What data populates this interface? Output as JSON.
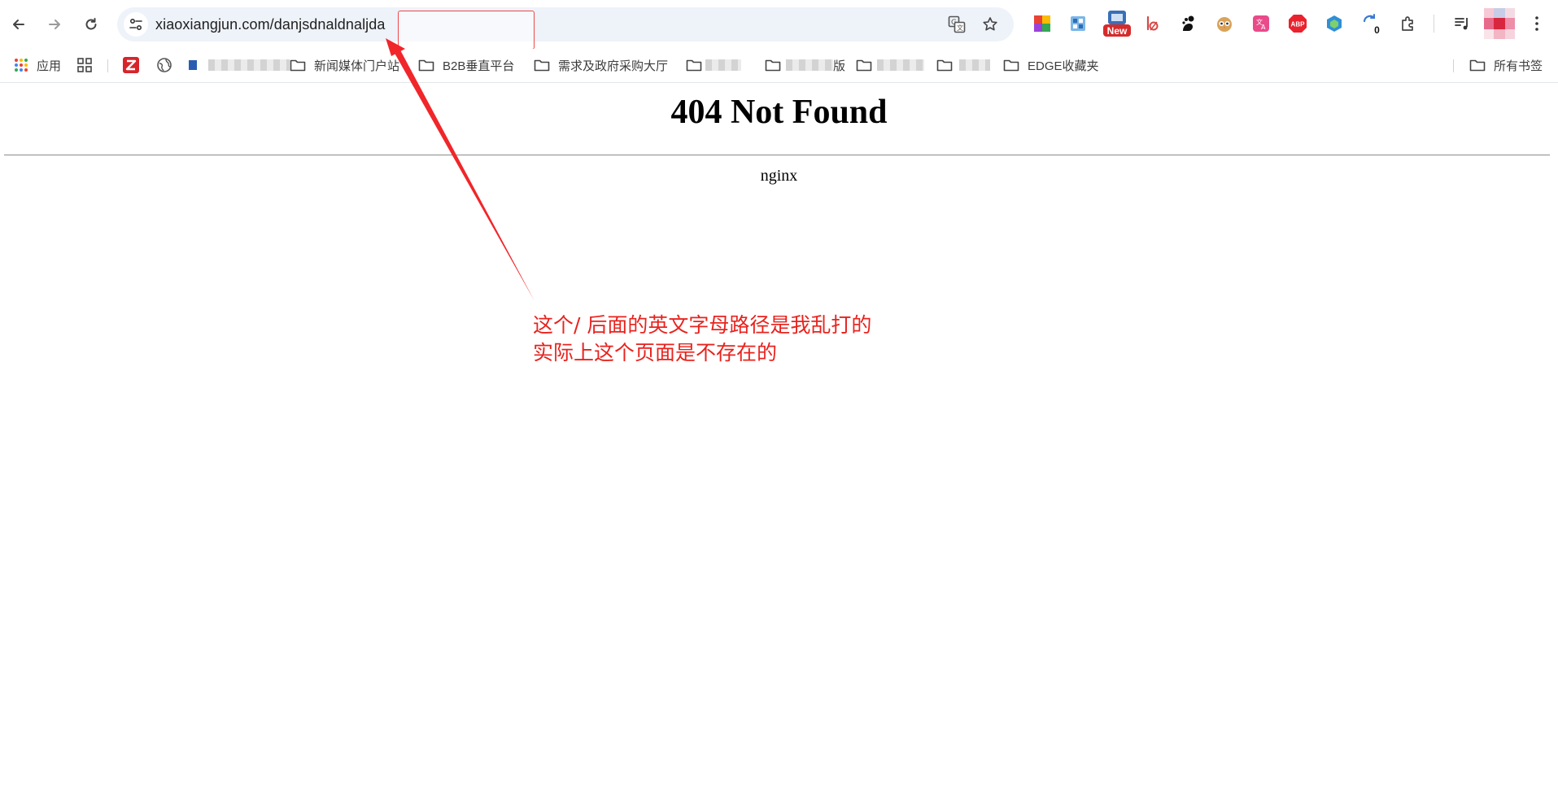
{
  "browser": {
    "url_host": "xiaoxiangjun.com/",
    "url_path": "danjsdnaldnaljda",
    "extension_badge": "New",
    "extension_abp": "ABP",
    "extension_count": "0"
  },
  "bookmarks": {
    "apps_label": "应用",
    "items": [
      "新闻媒体门户站",
      "B2B垂直平台",
      "需求及政府采购大厅",
      "",
      "版",
      "",
      "",
      "EDGE收藏夹"
    ],
    "all_bookmarks": "所有书签"
  },
  "page": {
    "heading": "404 Not Found",
    "server": "nginx"
  },
  "annotation": {
    "line1": "这个/ 后面的英文字母路径是我乱打的",
    "line2": "实际上这个页面是不存在的",
    "color": "#e8231e"
  }
}
